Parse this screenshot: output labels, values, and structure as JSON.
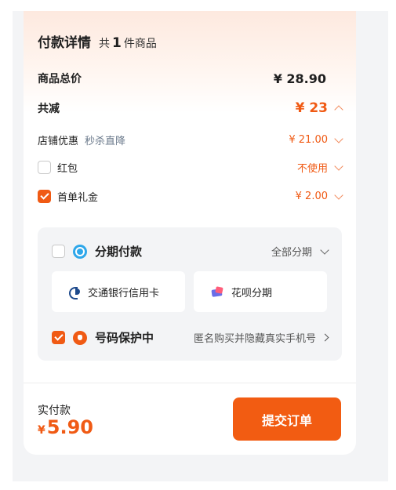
{
  "header": {
    "title": "付款详情",
    "count_prefix": "共",
    "count_num": "1",
    "count_suffix": "件商品"
  },
  "summary": {
    "total_label": "商品总价",
    "total_value": "¥ 28.90",
    "discount_label": "共减",
    "discount_value": "¥ 23"
  },
  "discounts": {
    "shop_label": "店铺优惠",
    "shop_sub": "秒杀直降",
    "shop_value": "¥ 21.00",
    "redpack_label": "红包",
    "redpack_checked": false,
    "redpack_value": "不使用",
    "firstorder_label": "首单礼金",
    "firstorder_checked": true,
    "firstorder_value": "¥ 2.00"
  },
  "installment": {
    "title": "分期付款",
    "checked": false,
    "option_label": "全部分期",
    "options": [
      {
        "label": "交通银行信用卡",
        "icon": "bocom-logo-icon"
      },
      {
        "label": "花呗分期",
        "icon": "huabei-icon"
      }
    ]
  },
  "privacy": {
    "title": "号码保护中",
    "checked": true,
    "description": "匿名购买并隐藏真实手机号"
  },
  "footer": {
    "pay_label": "实付款",
    "pay_currency": "¥",
    "pay_amount": "5.90",
    "submit_label": "提交订单"
  },
  "colors": {
    "accent": "#f05a14",
    "panel_bg": "#f3f4f6"
  }
}
